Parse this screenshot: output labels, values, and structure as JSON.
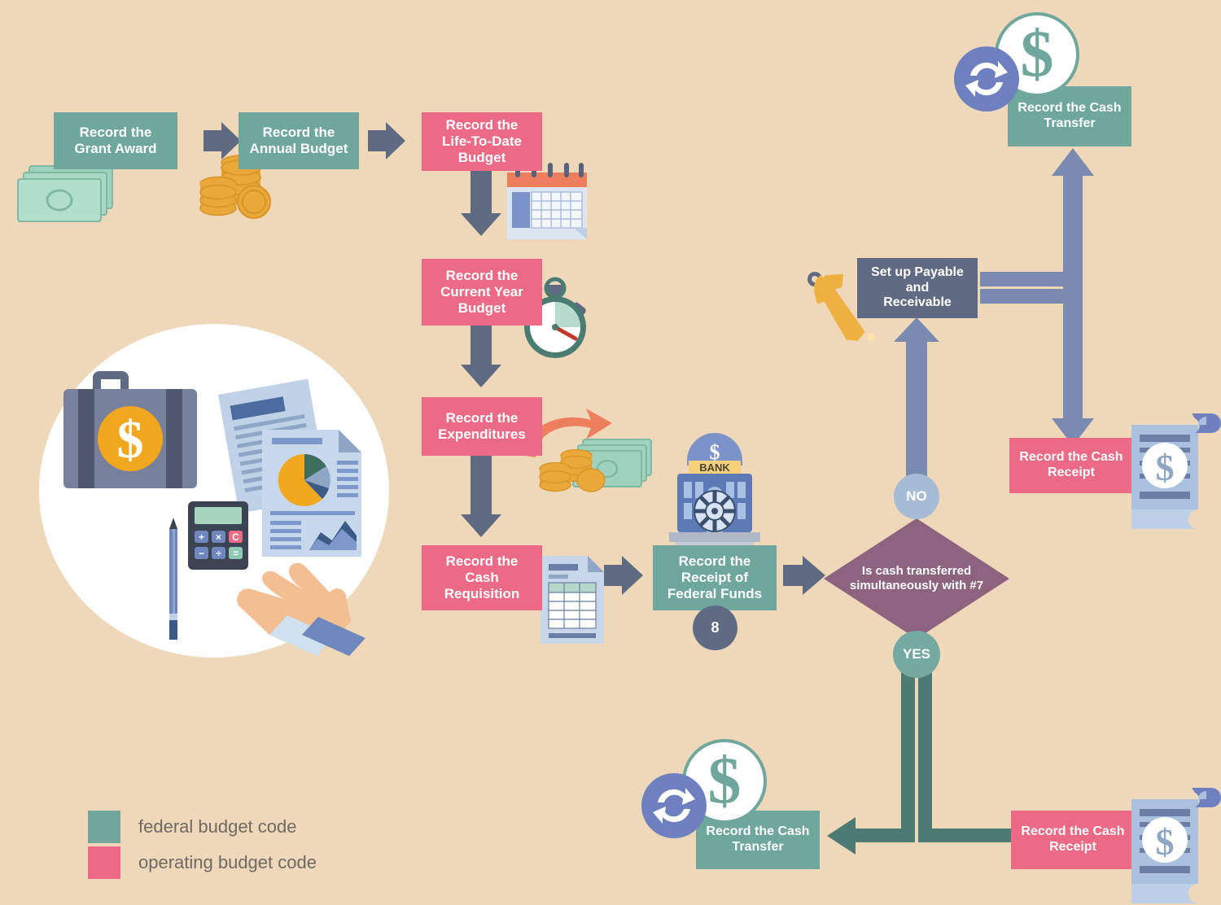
{
  "page": {
    "title": "Grant Budget and Cash Flow Accounting Flowchart",
    "background_color": "#EFD7BA"
  },
  "colors": {
    "federal_budget_code": "#6FA79C",
    "operating_budget_code": "#EC6A86",
    "process_slate": "#5F6A83",
    "decision_plum": "#8D6380",
    "arrow_blue": "#7B8AB0",
    "arrow_slate": "#5F6A83",
    "arrow_dark_teal": "#4D7A73",
    "no_badge": "#A6BBD6",
    "yes_badge": "#74AAA2"
  },
  "nodes": {
    "grant_award": {
      "label": "Record the\nGrant Award",
      "type": "federal"
    },
    "annual_budget": {
      "label": "Record the\nAnnual Budget",
      "type": "federal"
    },
    "life_to_date_budget": {
      "label": "Record the\nLife-To-Date\nBudget",
      "type": "operating"
    },
    "current_year_budget": {
      "label": "Record the\nCurrent Year\nBudget",
      "type": "operating"
    },
    "expenditures": {
      "label": "Record the\nExpenditures",
      "type": "operating"
    },
    "cash_requisition": {
      "label": "Record the\nCash\nRequisition",
      "type": "operating"
    },
    "receipt_federal_funds": {
      "label": "Record the\nReceipt of\nFederal Funds",
      "type": "federal",
      "badge": "8"
    },
    "decision": {
      "label": "Is cash transferred simultaneously with #7",
      "type": "decision"
    },
    "setup_payable_receivable": {
      "label": "Set up Payable\nand\nReceivable",
      "type": "process"
    },
    "cash_transfer_top": {
      "label": "Record the Cash\nTransfer",
      "type": "federal"
    },
    "cash_receipt_right": {
      "label": "Record the Cash\nReceipt",
      "type": "operating"
    },
    "cash_transfer_bottom": {
      "label": "Record the Cash\nTransfer",
      "type": "federal"
    },
    "cash_receipt_bottom": {
      "label": "Record the Cash\nReceipt",
      "type": "operating"
    }
  },
  "branch_labels": {
    "no": "NO",
    "yes": "YES"
  },
  "icons": {
    "banknotes": "banknotes-icon",
    "coins": "coins-icon",
    "calendar": "calendar-icon",
    "stopwatch": "stopwatch-icon",
    "money_return": "money-return-icon",
    "form_document": "form-document-icon",
    "bank": "bank-icon",
    "wrench": "wrench-icon",
    "dollar_coin_sync_top": "dollar-coin-sync-icon",
    "dollar_coin_sync_bottom": "dollar-coin-sync-icon",
    "receipt_scroll_right": "receipt-scroll-icon",
    "receipt_scroll_bottom": "receipt-scroll-icon",
    "briefcase": "briefcase-icon",
    "calculator": "calculator-icon",
    "pencil": "pencil-icon",
    "reports": "reports-icon",
    "hand": "hand-icon"
  },
  "calculator_keys": {
    "plus": "+",
    "times": "×",
    "clear": "C",
    "minus": "−",
    "divide": "÷",
    "equals": "="
  },
  "bank_sign": "BANK",
  "bank_dollar": "$",
  "legend": {
    "items": [
      {
        "label": "federal budget code",
        "color": "#6FA79C"
      },
      {
        "label": "operating budget code",
        "color": "#EC6A86"
      }
    ]
  }
}
